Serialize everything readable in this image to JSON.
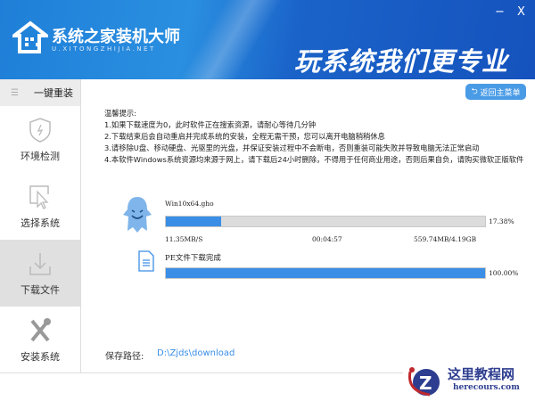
{
  "header": {
    "brand": "系统之家装机大师",
    "brand_url": "U.XITONGZHIJIA.NET",
    "slogan": "玩系统我们更专业",
    "minimize": "−",
    "close": "X"
  },
  "sidebar": {
    "head": "一键重装",
    "items": [
      {
        "label": "环境检测",
        "icon": "shield-icon"
      },
      {
        "label": "选择系统",
        "icon": "cursor-icon"
      },
      {
        "label": "下载文件",
        "icon": "download-icon",
        "active": true
      },
      {
        "label": "安装系统",
        "icon": "tools-icon"
      }
    ]
  },
  "main": {
    "back_button": "返回主菜单",
    "tips": {
      "title": "温馨提示:",
      "lines": [
        "1.如果下载速度为0，此时软件正在搜索资源，请耐心等待几分钟",
        "2.下载结束后会自动重启并完成系统的安装，全程无需干预，您可以离开电脑稍稍休息",
        "3.请移除U盘、移动硬盘、光驱里的光盘，并保证安装过程中不会断电，否则重装可能失败并导致电脑无法正常启动",
        "4.本软件Windows系统资源均来源于网上，请下载后24小时删除，不得用于任何商业用途，否则后果自负，请购买微软正版软件"
      ]
    },
    "downloads": [
      {
        "name": "Win10x64.gho",
        "progress": 17.38,
        "progress_label": "17.38%",
        "speed": "11.35MB/S",
        "time": "00:04:57",
        "size": "559.74MB/4.19GB"
      },
      {
        "name": "PE文件下载完成",
        "progress": 100,
        "progress_label": "100.00%"
      }
    ],
    "save_path_label": "保存路径:",
    "save_path": "D:\\Zjds\\download"
  },
  "watermark": {
    "title": "这里教程网",
    "url": "herecours.com"
  },
  "colors": {
    "accent": "#3a8ee6",
    "header": "#1a63c9"
  }
}
